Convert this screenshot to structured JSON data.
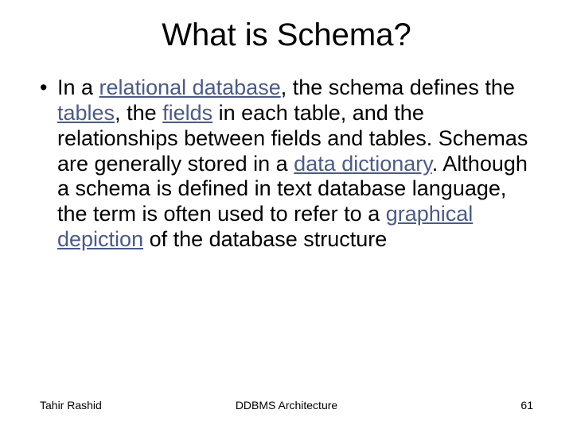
{
  "title": "What is Schema?",
  "bullet": {
    "mark": "•",
    "seg1": "In a ",
    "link1": "relational database",
    "seg2": ", the schema defines the ",
    "link2": "tables",
    "seg3": ", the ",
    "link3": "fields",
    "seg4": " in each table, and the relationships between fields and tables. Schemas are generally stored in a ",
    "link4": "data dictionary",
    "seg5": ". Although a schema is defined in text database language, the term is often used to refer to a ",
    "link5": "graphical depiction",
    "seg6": " of the database structure"
  },
  "footer": {
    "left": "Tahir Rashid",
    "center": "DDBMS Architecture",
    "right": "61"
  }
}
